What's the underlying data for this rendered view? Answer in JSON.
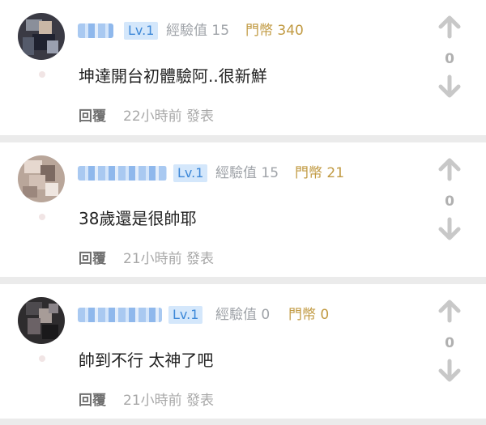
{
  "comments": [
    {
      "level": "Lv.1",
      "exp_label": "經驗值 15",
      "coin_label": "門幣 340",
      "content": "坤達開台初體驗阿..很新鮮",
      "reply_label": "回覆",
      "time_post": "22小時前 發表",
      "vote_count": "0"
    },
    {
      "level": "Lv.1",
      "exp_label": "經驗值 15",
      "coin_label": "門幣 21",
      "content": "38歲還是很帥耶",
      "reply_label": "回覆",
      "time_post": "21小時前 發表",
      "vote_count": "0"
    },
    {
      "level": "Lv.1",
      "exp_label": "經驗值 0",
      "coin_label": "門幣 0",
      "content": "帥到不行 太神了吧",
      "reply_label": "回覆",
      "time_post": "21小時前 發表",
      "vote_count": "0"
    }
  ],
  "colors": {
    "level_badge_bg": "#d4e7fb",
    "level_badge_text": "#3d88d8",
    "coin_text": "#c19a42",
    "separator": "#ebebeb"
  },
  "icons": [
    "arrow-up-icon",
    "arrow-down-icon"
  ]
}
